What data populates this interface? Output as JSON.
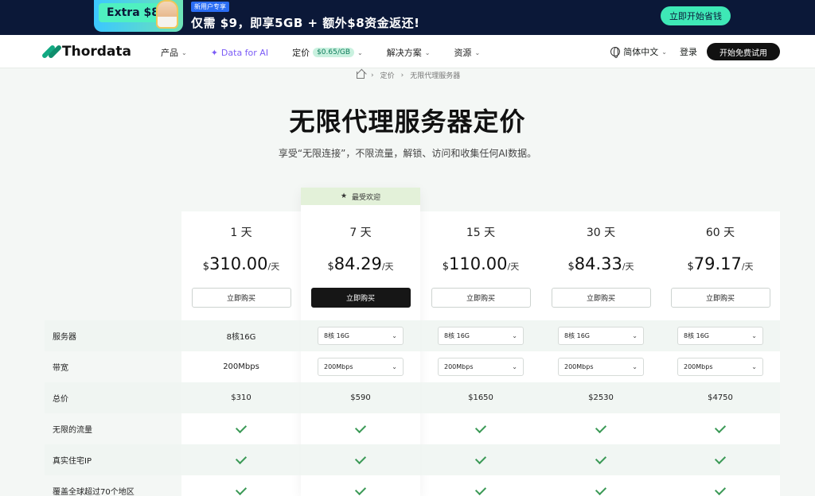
{
  "promo": {
    "card_label": "Extra $8",
    "tag": "新用户专享",
    "text": "仅需 $9，即享5GB + 额外$8资金返还!",
    "cta": "立即开始省钱"
  },
  "nav": {
    "logo": "Thordata",
    "items": [
      {
        "label": "产品"
      },
      {
        "label": "Data for AI"
      },
      {
        "label": "定价",
        "badge": "$0.65/GB"
      },
      {
        "label": "解决方案"
      },
      {
        "label": "资源"
      }
    ],
    "language": "简体中文",
    "login": "登录",
    "trial": "开始免费试用"
  },
  "breadcrumb": [
    "定价",
    "无限代理服务器"
  ],
  "hero": {
    "title": "无限代理服务器定价",
    "subtitle": "享受“无限连接”，不限流量，解锁、访问和收集任何AI数据。"
  },
  "popular_tag": "最受欢迎",
  "plans": [
    {
      "duration": "1 天",
      "currency": "$",
      "price": "310.00",
      "unit": "/天",
      "buy": "立即购买",
      "server": "8核16G",
      "bandwidth": "200Mbps",
      "total": "$310"
    },
    {
      "duration": "7 天",
      "currency": "$",
      "price": "84.29",
      "unit": "/天",
      "buy": "立即购买",
      "server": "8核 16G",
      "bandwidth": "200Mbps",
      "total": "$590"
    },
    {
      "duration": "15 天",
      "currency": "$",
      "price": "110.00",
      "unit": "/天",
      "buy": "立即购买",
      "server": "8核 16G",
      "bandwidth": "200Mbps",
      "total": "$1650"
    },
    {
      "duration": "30 天",
      "currency": "$",
      "price": "84.33",
      "unit": "/天",
      "buy": "立即购买",
      "server": "8核 16G",
      "bandwidth": "200Mbps",
      "total": "$2530"
    },
    {
      "duration": "60 天",
      "currency": "$",
      "price": "79.17",
      "unit": "/天",
      "buy": "立即购买",
      "server": "8核 16G",
      "bandwidth": "200Mbps",
      "total": "$4750"
    }
  ],
  "row_labels": {
    "server": "服务器",
    "bandwidth": "带宽",
    "total": "总价",
    "unlimited_traffic": "无限的流量",
    "residential_ip": "真实住宅IP",
    "global": "覆盖全球超过70个地区"
  }
}
